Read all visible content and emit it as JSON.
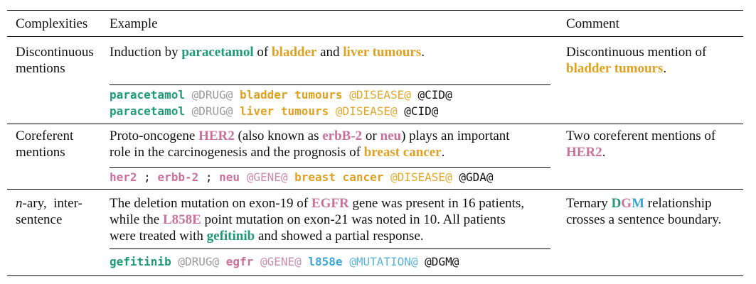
{
  "header": {
    "col1": "Complexities",
    "col2": "Example",
    "col3": "Comment"
  },
  "rows": [
    {
      "complexity": [
        "Discontinuous",
        "mentions"
      ],
      "sentence": {
        "p1": "Induction by ",
        "e1": "paracetamol",
        "p2": " of ",
        "e2": "bladder",
        "p3": " and ",
        "e3": "liver tumours",
        "p4": "."
      },
      "linearized": [
        {
          "drug": "paracetamol",
          "drug_tag": "@DRUG@",
          "dis": "bladder tumours",
          "dis_tag": "@DISEASE@",
          "rel": "@CID@"
        },
        {
          "drug": "paracetamol",
          "drug_tag": "@DRUG@",
          "dis": "liver tumours",
          "dis_tag": "@DISEASE@",
          "rel": "@CID@"
        }
      ],
      "comment": {
        "l1": "Discontinuous mention of",
        "l2_ent": "bladder tumours",
        "l2_end": "."
      }
    },
    {
      "complexity": [
        "Coreferent",
        "mentions"
      ],
      "sentence": {
        "p1": "Proto-oncogene ",
        "e1": "HER2",
        "p2": " (also known as ",
        "e2": "erbB-2",
        "p3": " or ",
        "e3": "neu",
        "p4": ") plays an important",
        "p5": "role in the carcinogenesis and the prognosis of ",
        "e4": "breast cancer",
        "p6": "."
      },
      "linearized": {
        "g1": "her2",
        "sep1": " ; ",
        "g2": "erbb-2",
        "sep2": " ; ",
        "g3": "neu",
        "gene_tag": "@GENE@",
        "dis": "breast cancer",
        "dis_tag": "@DISEASE@",
        "rel": "@GDA@"
      },
      "comment": {
        "l1": "Two coreferent mentions of",
        "l2_ent": "HER2",
        "l2_end": "."
      }
    },
    {
      "complexity": {
        "ital": "n",
        "rest1": "-ary,  inter-",
        "l2": "sentence"
      },
      "sentence": {
        "p1": "The deletion mutation on exon-19 of ",
        "e1": "EGFR",
        "p2": " gene was present in 16 patients,",
        "p3": "while the ",
        "e2": "L858E",
        "p4": " point mutation on exon-21 was noted in 10. All patients",
        "p5": "were treated with ",
        "e3": "gefitinib",
        "p6": " and showed a partial response."
      },
      "linearized": {
        "drug": "gefitinib",
        "drug_tag": "@DRUG@",
        "gene": "egfr",
        "gene_tag": "@GENE@",
        "mut": "l858e",
        "mut_tag": "@MUTATION@",
        "rel": "@DGM@"
      },
      "comment": {
        "l1_pre": "Ternary ",
        "l1_d": "D",
        "l1_g": "G",
        "l1_m": "M",
        "l1_post": " relationship",
        "l2": "crosses a sentence boundary."
      }
    }
  ]
}
